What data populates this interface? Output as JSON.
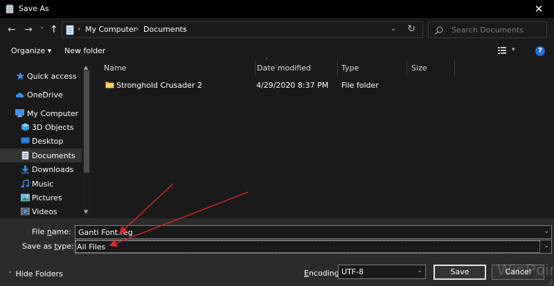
{
  "window": {
    "title": "Save As",
    "close_glyph": "✕"
  },
  "nav": {
    "back_glyph": "←",
    "forward_glyph": "→",
    "recent_glyph": "˅",
    "up_glyph": "↑",
    "breadcrumbs": [
      "My Computer",
      "Documents"
    ],
    "crumb_sep": "›",
    "dropdown_glyph": "⌄",
    "refresh_glyph": "↻",
    "search_placeholder": "Search Documents"
  },
  "toolbar": {
    "organize_label": "Organize ▾",
    "new_folder_label": "New folder",
    "view_dd_glyph": "▾",
    "help_glyph": "?"
  },
  "sidebar": {
    "items": [
      {
        "label": "Quick access",
        "icon": "star-icon"
      },
      {
        "label": "OneDrive",
        "icon": "cloud-icon"
      },
      {
        "label": "My Computer",
        "icon": "computer-icon"
      },
      {
        "label": "3D Objects",
        "icon": "cube-icon"
      },
      {
        "label": "Desktop",
        "icon": "desktop-icon"
      },
      {
        "label": "Documents",
        "icon": "document-icon"
      },
      {
        "label": "Downloads",
        "icon": "download-icon"
      },
      {
        "label": "Music",
        "icon": "music-icon"
      },
      {
        "label": "Pictures",
        "icon": "picture-icon"
      },
      {
        "label": "Videos",
        "icon": "video-icon"
      }
    ],
    "selected": "Documents",
    "scroll_up_glyph": "▲",
    "scroll_down_glyph": "▼"
  },
  "filelist": {
    "columns": [
      "Name",
      "Date modified",
      "Type",
      "Size"
    ],
    "sort_glyph": "˄",
    "rows": [
      {
        "name": "Stronghold Crusader 2",
        "date": "4/29/2020 8:37 PM",
        "type": "File folder",
        "size": ""
      }
    ]
  },
  "form": {
    "file_name_label_pre": "File ",
    "file_name_label_key": "n",
    "file_name_label_post": "ame:",
    "file_name_value": "Ganti Font.reg",
    "save_type_label_pre": "Save as ",
    "save_type_label_key": "t",
    "save_type_label_post": "ype:",
    "save_type_value": "All Files",
    "dropdown_glyph": "⌄"
  },
  "footer": {
    "hide_folders_label": "Hide Folders",
    "hide_folders_glyph": "˄",
    "encoding_label_key": "E",
    "encoding_label_rest": "ncoding:",
    "encoding_value": "UTF-8",
    "save_label": "Save",
    "cancel_label": "Cancel"
  },
  "watermark": "WinPoin",
  "colors": {
    "background": "#191919",
    "bottom_panel": "#2b2b2b",
    "selection": "#333333",
    "arrow_red": "#e0262a",
    "folder_yellow": "#e8c048",
    "accent_blue": "#1e6fd9"
  }
}
